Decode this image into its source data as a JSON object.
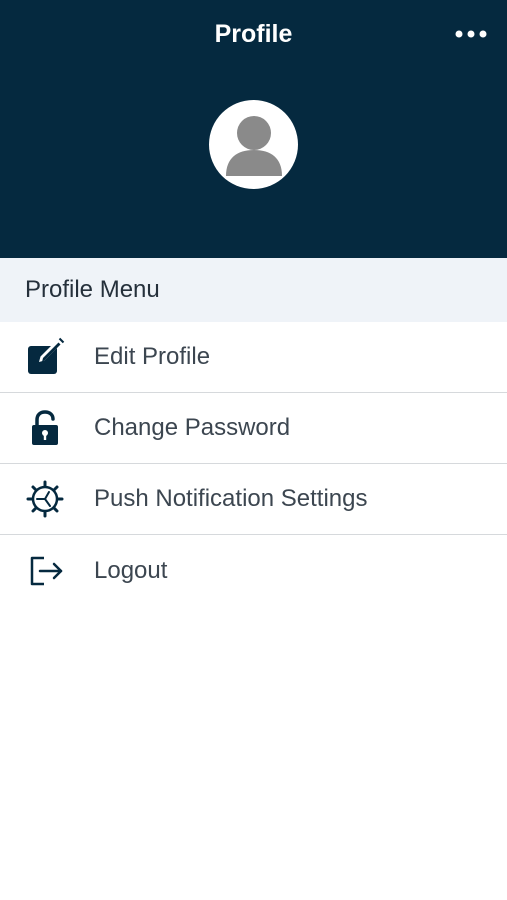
{
  "header": {
    "title": "Profile",
    "more_icon": "more-horizontal-icon",
    "avatar_icon": "user-avatar-icon",
    "background_color": "#05293f"
  },
  "profile_menu": {
    "title": "Profile Menu",
    "items": [
      {
        "label": "Edit Profile",
        "icon": "edit-icon"
      },
      {
        "label": "Change Password",
        "icon": "unlock-icon"
      },
      {
        "label": "Push Notification Settings",
        "icon": "gear-icon"
      },
      {
        "label": "Logout",
        "icon": "logout-icon"
      }
    ]
  }
}
